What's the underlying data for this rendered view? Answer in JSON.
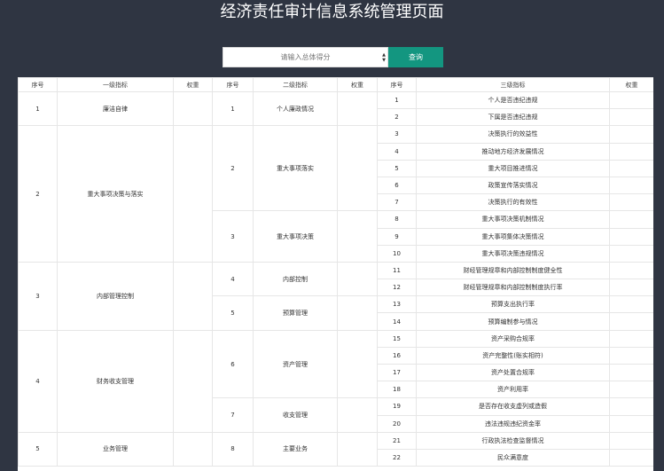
{
  "page": {
    "title": "经济责任审计信息系统管理页面"
  },
  "search": {
    "placeholder": "请输入总体得分",
    "button_label": "查询"
  },
  "table": {
    "headers": [
      "序号",
      "一级指标",
      "权重",
      "序号",
      "二级指标",
      "权重",
      "序号",
      "三级指标",
      "权重"
    ],
    "level1": [
      {
        "no": "1",
        "name": "廉洁自律",
        "weight": ""
      },
      {
        "no": "2",
        "name": "重大事项决策与落实",
        "weight": ""
      },
      {
        "no": "3",
        "name": "内部管理控制",
        "weight": ""
      },
      {
        "no": "4",
        "name": "财务收支管理",
        "weight": ""
      },
      {
        "no": "5",
        "name": "业务管理",
        "weight": ""
      }
    ],
    "level2": [
      {
        "no": "1",
        "name": "个人廉政情况",
        "weight": ""
      },
      {
        "no": "2",
        "name": "重大事项落实",
        "weight": ""
      },
      {
        "no": "3",
        "name": "重大事项决策",
        "weight": ""
      },
      {
        "no": "4",
        "name": "内部控制",
        "weight": ""
      },
      {
        "no": "5",
        "name": "预算管理",
        "weight": ""
      },
      {
        "no": "6",
        "name": "资产管理",
        "weight": ""
      },
      {
        "no": "7",
        "name": "收支管理",
        "weight": ""
      },
      {
        "no": "8",
        "name": "主要业务",
        "weight": ""
      }
    ],
    "level3": [
      {
        "no": "1",
        "name": "个人是否违纪违规",
        "weight": ""
      },
      {
        "no": "2",
        "name": "下属是否违纪违规",
        "weight": ""
      },
      {
        "no": "3",
        "name": "决策执行的效益性",
        "weight": ""
      },
      {
        "no": "4",
        "name": "推动地方经济发展情况",
        "weight": ""
      },
      {
        "no": "5",
        "name": "重大项目推进情况",
        "weight": ""
      },
      {
        "no": "6",
        "name": "政策宣传落实情况",
        "weight": ""
      },
      {
        "no": "7",
        "name": "决策执行的有效性",
        "weight": ""
      },
      {
        "no": "8",
        "name": "重大事项决策机制情况",
        "weight": ""
      },
      {
        "no": "9",
        "name": "重大事项集体决策情况",
        "weight": ""
      },
      {
        "no": "10",
        "name": "重大事项决策违规情况",
        "weight": ""
      },
      {
        "no": "11",
        "name": "财经管理规章和内部控制制度健全性",
        "weight": ""
      },
      {
        "no": "12",
        "name": "财经管理规章和内部控制制度执行率",
        "weight": ""
      },
      {
        "no": "13",
        "name": "预算支出执行率",
        "weight": ""
      },
      {
        "no": "14",
        "name": "预算编制参与情况",
        "weight": ""
      },
      {
        "no": "15",
        "name": "资产采购合规率",
        "weight": ""
      },
      {
        "no": "16",
        "name": "资产完整性(账实相符)",
        "weight": ""
      },
      {
        "no": "17",
        "name": "资产处置合规率",
        "weight": ""
      },
      {
        "no": "18",
        "name": "资产利用率",
        "weight": ""
      },
      {
        "no": "19",
        "name": "是否存在收支虚列或造假",
        "weight": ""
      },
      {
        "no": "20",
        "name": "违法违规违纪资金率",
        "weight": ""
      },
      {
        "no": "21",
        "name": "行政执法检查监督情况",
        "weight": ""
      },
      {
        "no": "22",
        "name": "民众满意度",
        "weight": ""
      }
    ]
  }
}
